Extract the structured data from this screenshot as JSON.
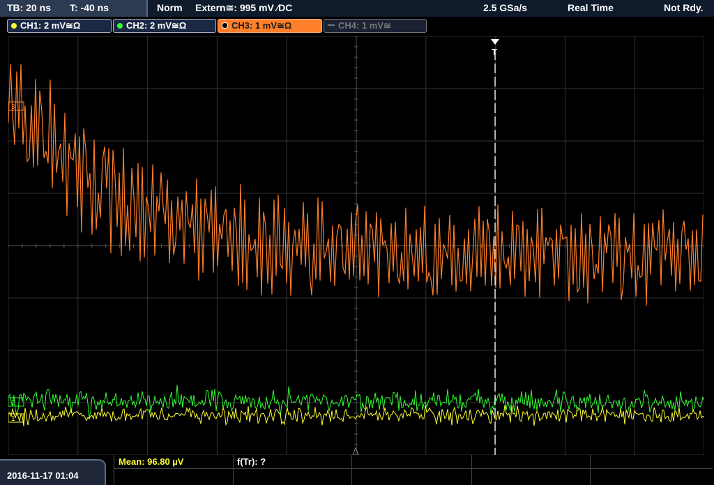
{
  "status": {
    "timebase": "TB: 20 ns",
    "trigger_pos": "T: -40 ns",
    "mode": "Norm",
    "trigger_source": "Extern≅: 995 mV ∕DC",
    "sample_rate": "2.5 GSa/s",
    "acq_mode": "Real Time",
    "state": "Not Rdy."
  },
  "channels": [
    {
      "label": "CH1: 2 mV≅Ω",
      "color": "#ffff33"
    },
    {
      "label": "CH2: 2 mV≅Ω",
      "color": "#33ff33"
    },
    {
      "label": "CH3: 1 mV≅Ω",
      "color": "#ff7f2a"
    },
    {
      "label": "CH4: 1 mV≅",
      "color": "#666666"
    }
  ],
  "markers": {
    "trigger": "T",
    "ch3_level": "3",
    "ch2_level": "2",
    "ch1_level": "1"
  },
  "footer": {
    "datetime": "2016-11-17 01:04",
    "mean": "Mean: 96.80 µV",
    "freq": "f(Tr): ?"
  },
  "colors": {
    "grid": "#3a3a3a",
    "ch1": "#ffff33",
    "ch2": "#33ff33",
    "ch3": "#ff7f2a",
    "cursor": "#ffffff"
  }
}
